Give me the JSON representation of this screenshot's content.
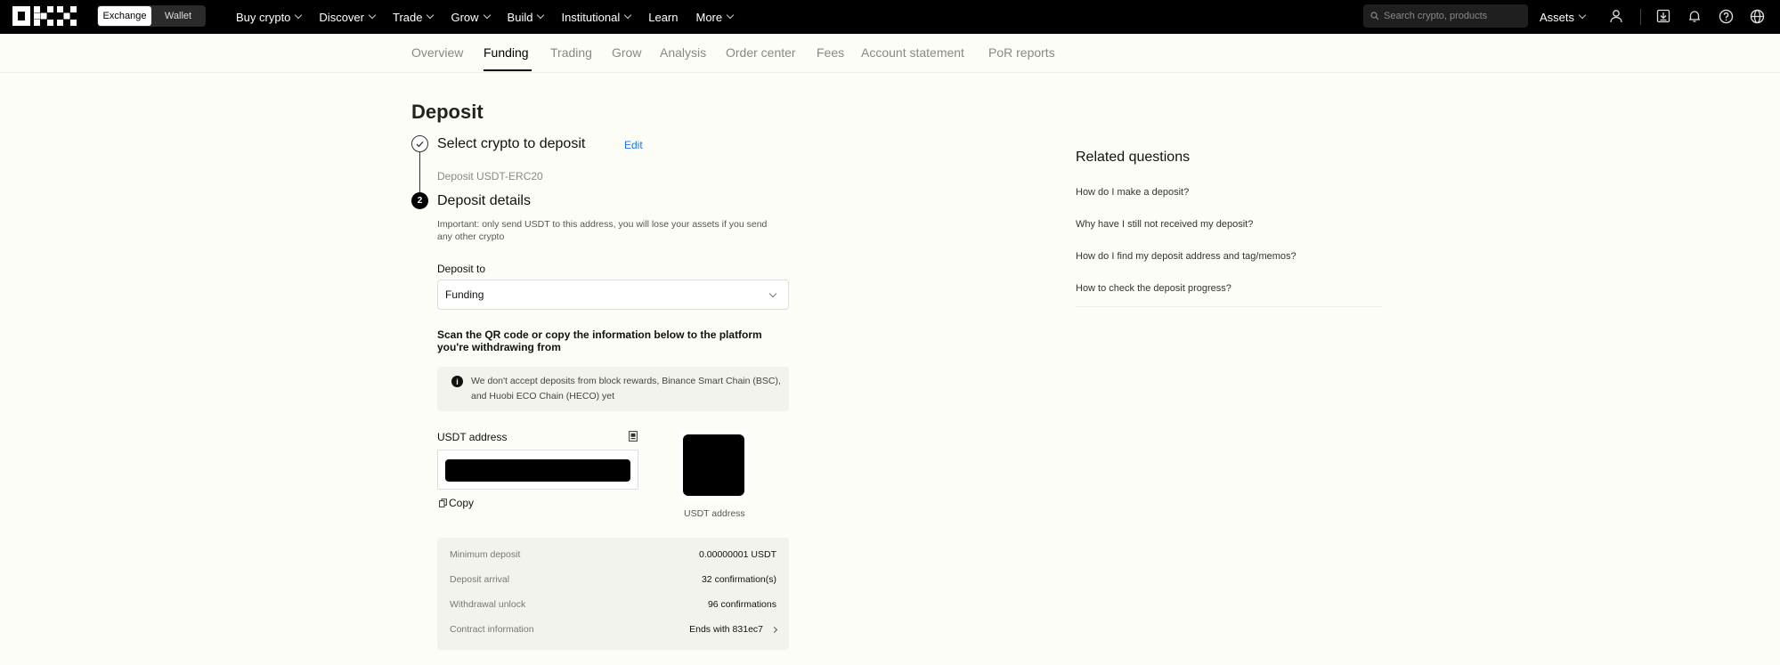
{
  "topbar": {
    "logo_text": "OKX",
    "segment": {
      "exchange": "Exchange",
      "wallet": "Wallet"
    },
    "nav": [
      {
        "label": "Buy crypto",
        "has_dropdown": true
      },
      {
        "label": "Discover",
        "has_dropdown": true
      },
      {
        "label": "Trade",
        "has_dropdown": true
      },
      {
        "label": "Grow",
        "has_dropdown": true
      },
      {
        "label": "Build",
        "has_dropdown": true
      },
      {
        "label": "Institutional",
        "has_dropdown": true
      },
      {
        "label": "Learn",
        "has_dropdown": false
      },
      {
        "label": "More",
        "has_dropdown": true
      }
    ],
    "search_placeholder": "Search crypto, products",
    "assets_label": "Assets",
    "icons": [
      "user-icon",
      "download-icon",
      "bell-icon",
      "help-icon",
      "globe-icon"
    ]
  },
  "subnav": {
    "tabs": [
      "Overview",
      "Funding",
      "Trading",
      "Grow",
      "Analysis",
      "Order center",
      "Fees",
      "Account statement",
      "PoR reports"
    ],
    "active": "Funding"
  },
  "page": {
    "title": "Deposit",
    "step1": {
      "title": "Select crypto to deposit",
      "edit": "Edit",
      "selected": "Deposit USDT-ERC20"
    },
    "step2": {
      "number": "2",
      "title": "Deposit details",
      "important": "Important: only send USDT to this address, you will lose your assets if you send any other crypto"
    },
    "deposit_to": {
      "label": "Deposit to",
      "value": "Funding"
    },
    "scan_text_a": "Scan the QR code",
    "scan_text_or": "or",
    "scan_text_b": "copy the information below to the platform you're withdrawing from",
    "notice": "We don't accept deposits from block rewards, Binance Smart Chain (BSC), and Huobi ECO Chain (HECO) yet",
    "address": {
      "label": "USDT address",
      "copy": "Copy",
      "qr_caption": "USDT address"
    },
    "info": [
      {
        "key": "Minimum deposit",
        "value": "0.00000001 USDT"
      },
      {
        "key": "Deposit arrival",
        "value": "32 confirmation(s)"
      },
      {
        "key": "Withdrawal unlock",
        "value": "96 confirmations"
      },
      {
        "key": "Contract information",
        "value": "Ends with 831ec7"
      }
    ]
  },
  "related": {
    "title": "Related questions",
    "questions": [
      "How do I make a deposit?",
      "Why have I still not received my deposit?",
      "How do I find my deposit address and tag/memos?",
      "How to check the deposit progress?"
    ]
  },
  "colors": {
    "accent_link": "#1a73e8",
    "topbar_bg": "#000000",
    "page_bg": "#fdfdf8"
  }
}
